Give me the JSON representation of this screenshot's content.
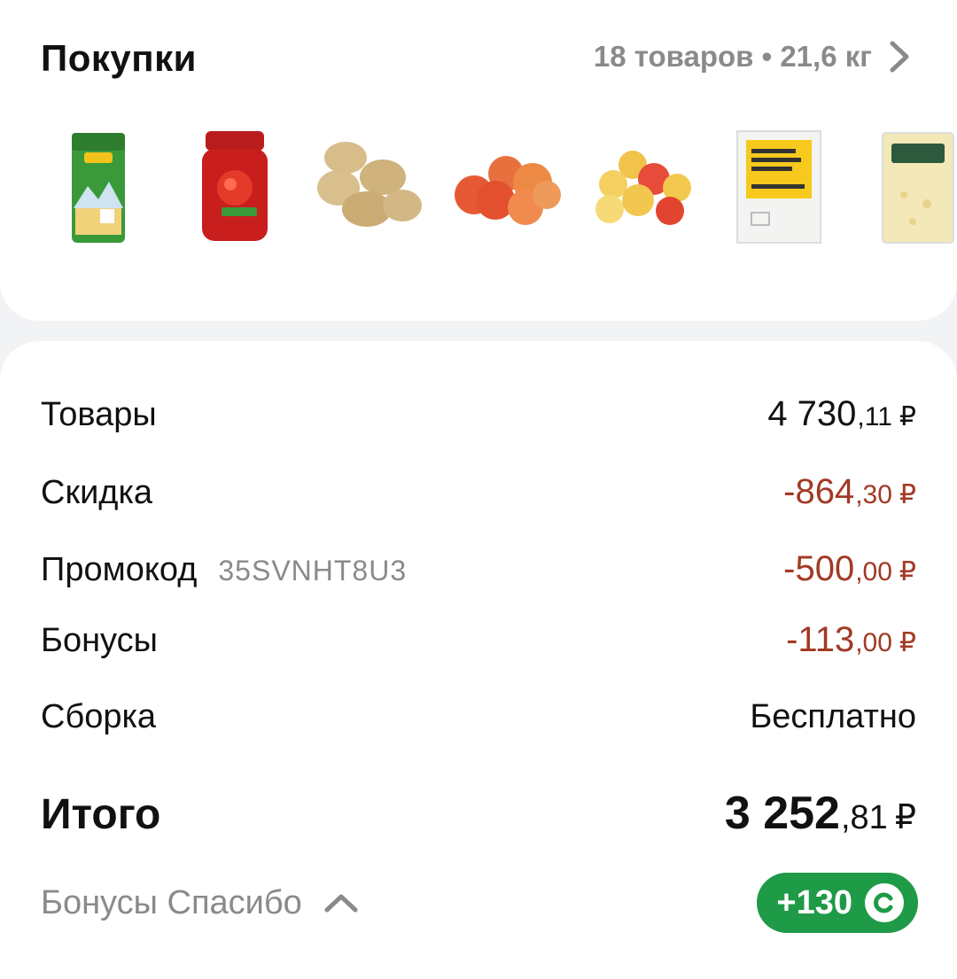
{
  "purchases": {
    "title": "Покупки",
    "summary": "18 товаров • 21,6 кг",
    "products": [
      {
        "name": "pasta-pack"
      },
      {
        "name": "tomato-paste-jar"
      },
      {
        "name": "potatoes"
      },
      {
        "name": "red-apples"
      },
      {
        "name": "yellow-apples"
      },
      {
        "name": "butter-pack"
      },
      {
        "name": "cheese-pack"
      }
    ]
  },
  "summary": {
    "goods": {
      "label": "Товары",
      "int": "4 730",
      "kop": ",11",
      "cur": "₽"
    },
    "discount": {
      "label": "Скидка",
      "int": "-864",
      "kop": ",30",
      "cur": "₽"
    },
    "promo": {
      "label": "Промокод",
      "code": "35SVNHT8U3",
      "int": "-500",
      "kop": ",00",
      "cur": "₽"
    },
    "bonuses": {
      "label": "Бонусы",
      "int": "-113",
      "kop": ",00",
      "cur": "₽"
    },
    "assembly": {
      "label": "Сборка",
      "value": "Бесплатно"
    },
    "total": {
      "label": "Итого",
      "int": "3 252",
      "kop": ",81",
      "cur": "₽"
    }
  },
  "bonus_program": {
    "label": "Бонусы Спасибо",
    "value": "+130"
  },
  "colors": {
    "negative": "#a23a24",
    "bonus_green": "#1f9a47",
    "muted": "#8a8a8a"
  }
}
